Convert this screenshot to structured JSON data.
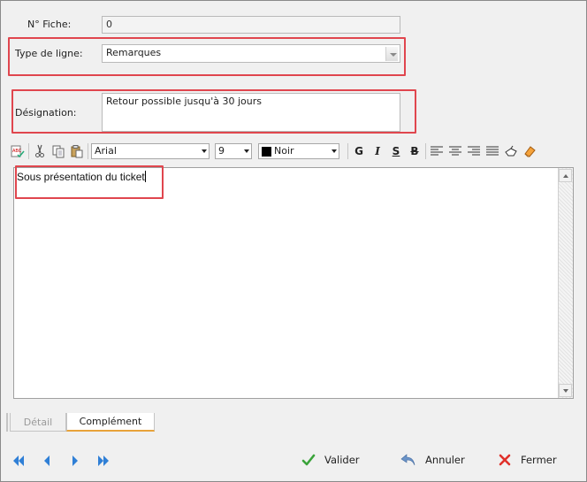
{
  "form": {
    "fiche_label": "N° Fiche:",
    "fiche_value": "0",
    "type_label": "Type de ligne:",
    "type_value": "Remarques",
    "designation_label": "Désignation:",
    "designation_value": "Retour possible jusqu'à 30 jours"
  },
  "toolbar": {
    "font": "Arial",
    "size": "9",
    "color_label": "Noir",
    "color_swatch": "#000000",
    "bold": "G",
    "italic": "I",
    "underline": "S",
    "strike": "B"
  },
  "editor": {
    "content": "Sous présentation du ticket"
  },
  "tabs": [
    {
      "label": "Détail",
      "active": false
    },
    {
      "label": "Complément",
      "active": true
    }
  ],
  "actions": {
    "validate": "Valider",
    "cancel": "Annuler",
    "close": "Fermer"
  },
  "colors": {
    "highlight": "#e0464e",
    "nav_blue": "#2f7fd6",
    "validate_green": "#3aa33a",
    "close_red": "#e0302a",
    "tab_accent": "#e8a33a"
  }
}
